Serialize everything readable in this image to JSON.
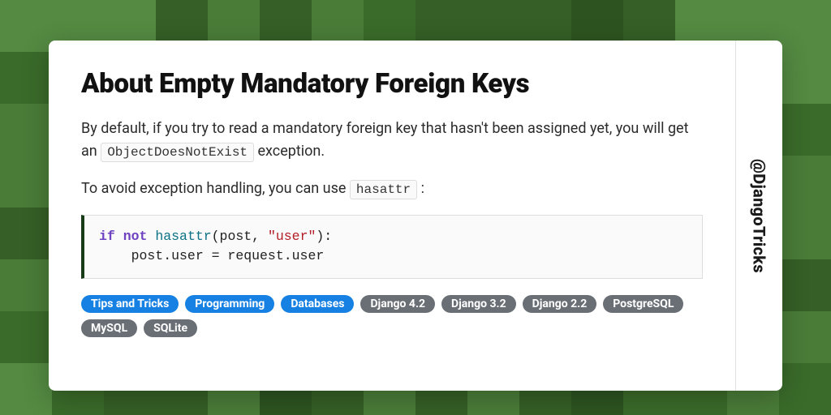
{
  "handle": "@DjangoTricks",
  "title": "About Empty Mandatory Foreign Keys",
  "para1_before": "By default, if you try to read a mandatory foreign key that hasn't been assigned yet, you will get an ",
  "para1_code": "ObjectDoesNotExist",
  "para1_after": " exception.",
  "para2_before": "To avoid exception handling, you can use ",
  "para2_code": "hasattr",
  "para2_after": " :",
  "code": {
    "kw_if": "if",
    "kw_not": "not",
    "fn_hasattr": "hasattr",
    "open": "(post, ",
    "str_user": "\"user\"",
    "close": "):",
    "line2": "    post.user = request.user"
  },
  "tags": [
    {
      "label": "Tips and Tricks",
      "style": "blue"
    },
    {
      "label": "Programming",
      "style": "blue"
    },
    {
      "label": "Databases",
      "style": "blue"
    },
    {
      "label": "Django 4.2",
      "style": "gray"
    },
    {
      "label": "Django 3.2",
      "style": "gray"
    },
    {
      "label": "Django 2.2",
      "style": "gray"
    },
    {
      "label": "PostgreSQL",
      "style": "gray"
    },
    {
      "label": "MySQL",
      "style": "gray"
    },
    {
      "label": "SQLite",
      "style": "gray"
    }
  ]
}
